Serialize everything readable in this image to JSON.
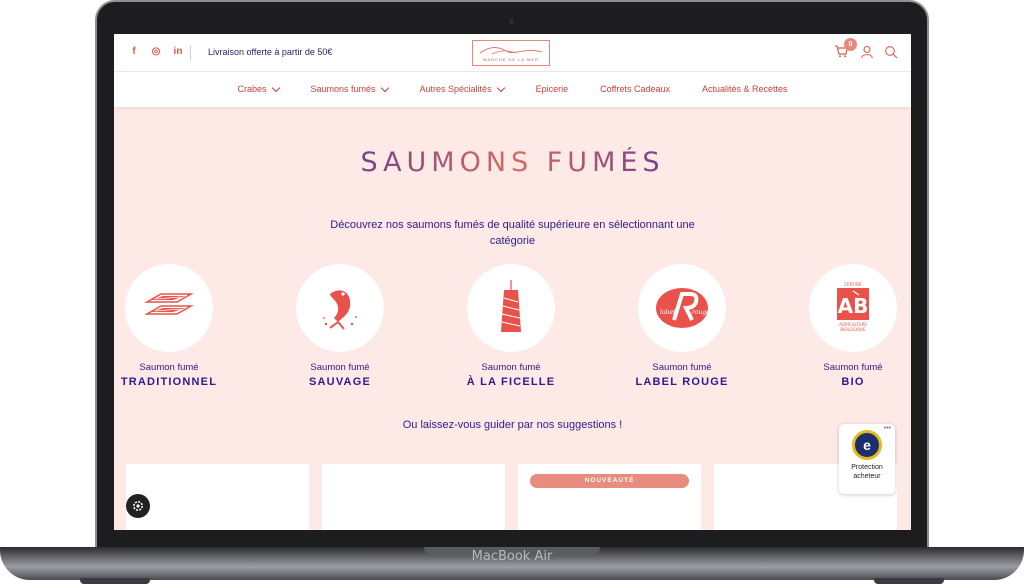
{
  "device_label": "MacBook Air",
  "header": {
    "social": [
      "f",
      "◎",
      "in"
    ],
    "promo": "Livraison offerte à partir de 50€",
    "logo_text": "MARCHÉ DE LA MER",
    "cart_count": "0"
  },
  "nav": {
    "items": [
      {
        "label": "Crabes",
        "dropdown": true
      },
      {
        "label": "Saumons fumés",
        "dropdown": true
      },
      {
        "label": "Autres Spécialités",
        "dropdown": true
      },
      {
        "label": "Epicerie",
        "dropdown": false
      },
      {
        "label": "Coffrets Cadeaux",
        "dropdown": false
      },
      {
        "label": "Actualités & Recettes",
        "dropdown": false
      }
    ]
  },
  "page": {
    "title": "SAUMONS FUMÉS",
    "intro": "Découvrez nos saumons fumés de qualité supérieure en sélectionnant une catégorie",
    "suggest": "Ou laissez-vous guider par nos suggestions !"
  },
  "categories": [
    {
      "sub": "Saumon fumé",
      "name": "TRADITIONNEL",
      "icon": "sliced-salmon-icon"
    },
    {
      "sub": "Saumon fumé",
      "name": "SAUVAGE",
      "icon": "jumping-fish-icon"
    },
    {
      "sub": "Saumon fumé",
      "name": "À LA FICELLE",
      "icon": "hanging-fillet-icon"
    },
    {
      "sub": "Saumon fumé",
      "name": "LABEL ROUGE",
      "icon": "label-rouge-logo"
    },
    {
      "sub": "Saumon fumé",
      "name": "BIO",
      "icon": "ab-organic-logo"
    }
  ],
  "cards": {
    "badge": "NOUVEAUTÉ"
  },
  "trust": {
    "line1": "Protection",
    "line2": "acheteur",
    "seal": "e",
    "menu": "•••"
  },
  "colors": {
    "accent": "#e05a4a",
    "navy": "#2e1a8e",
    "background": "#fde9e6"
  }
}
